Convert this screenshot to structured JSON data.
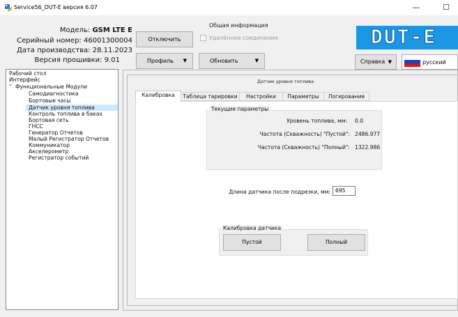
{
  "window": {
    "title": "Service56_DUT-E версия 6.07",
    "minimize": "—",
    "maximize": "☐"
  },
  "info": {
    "model_label": "Модель:",
    "model_value": "GSM LTE E",
    "serial_label": "Серийный номер:",
    "serial_value": "46001300004",
    "date_label": "Дата производства:",
    "date_value": "28.11.2023",
    "firmware_label": "Версия прошивки:",
    "firmware_value": "9.01"
  },
  "toolbar": {
    "section_title": "Общая информация",
    "disconnect": "Отключить",
    "remote_connection": "Удалённое соединение",
    "profile": "Профиль",
    "refresh": "Обновить",
    "help": "Справка",
    "language": "русский",
    "logo": "DUT-E"
  },
  "tree": {
    "items": [
      "Рабочий стол",
      "Интерфейс",
      "Функциональные Модули",
      "Самодиагностика",
      "Бортовые часы",
      "Датчик уровня топлива",
      "Контроль топлива в баках",
      "Бортовая сеть",
      "ГНСС",
      "Генератор Отчетов",
      "Малый Регистратор Отчетов",
      "Коммуникатор",
      "Акселерометр",
      "Регистратор событий"
    ],
    "expand_glyph": "⌄"
  },
  "main": {
    "title": "Датчик уровня топлива",
    "tabs": [
      "Калибровка",
      "Таблица тарировки",
      "Настройки",
      "Параметры",
      "Логирование"
    ],
    "current_params": {
      "title": "Текущие параметры",
      "level_label": "Уровень топлива, мм:",
      "level_value": "0.0",
      "freq_empty_label": "Частота (Скважность) \"Пустой\":",
      "freq_empty_value": "2486.977",
      "freq_full_label": "Частота (Скважность) \"Полный\":",
      "freq_full_value": "1322.986"
    },
    "length_label": "Длина датчика после подрезки, мм:",
    "length_value": "695",
    "calibration": {
      "title": "Калибровка датчика",
      "empty": "Пустой",
      "full": "Полный"
    }
  },
  "colors": {
    "logo_bg": "#1b97e4",
    "selection": "#cce8ff",
    "window_bg": "#f0f0f0"
  }
}
